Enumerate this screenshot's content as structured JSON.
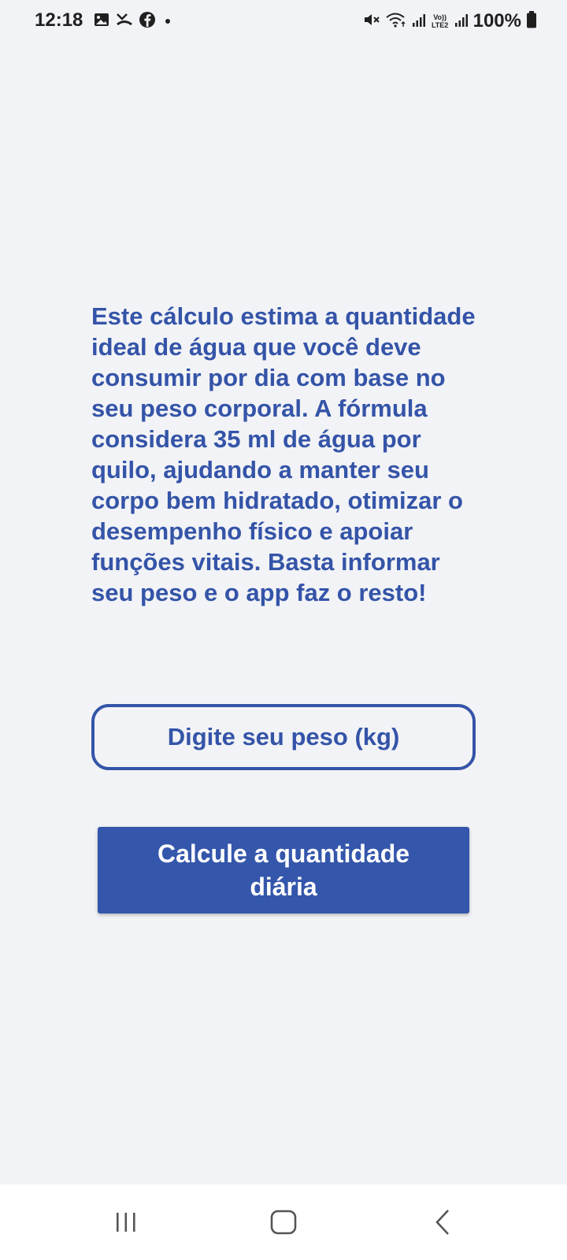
{
  "status_bar": {
    "time": "12:18",
    "battery": "100%",
    "left_icons": [
      "image-icon",
      "missed-call-icon",
      "facebook-icon",
      "notification-dot-icon"
    ],
    "right_icons": [
      "mute-icon",
      "wifi-icon",
      "signal-icon",
      "volte-icon",
      "signal-icon",
      "battery-icon"
    ],
    "volte_label": "Vo)) LTE2"
  },
  "main": {
    "description": "Este cálculo estima a quantidade ideal de água que você deve consumir por dia com base no seu peso corporal. A fórmula considera 35 ml de água por quilo, ajudando a manter seu corpo bem hidratado, otimizar o desempenho físico e apoiar funções vitais. Basta informar seu peso e o app faz o resto!",
    "weight_input": {
      "placeholder": "Digite seu peso (kg)",
      "value": ""
    },
    "calculate_button": "Calcule a quantidade diária"
  },
  "nav_bar": {
    "items": [
      "recent-apps-icon",
      "home-icon",
      "back-icon"
    ]
  },
  "colors": {
    "accent": "#3454a8",
    "background": "#f2f3f6",
    "button_bg": "#3456ab",
    "button_text": "#ffffff"
  }
}
